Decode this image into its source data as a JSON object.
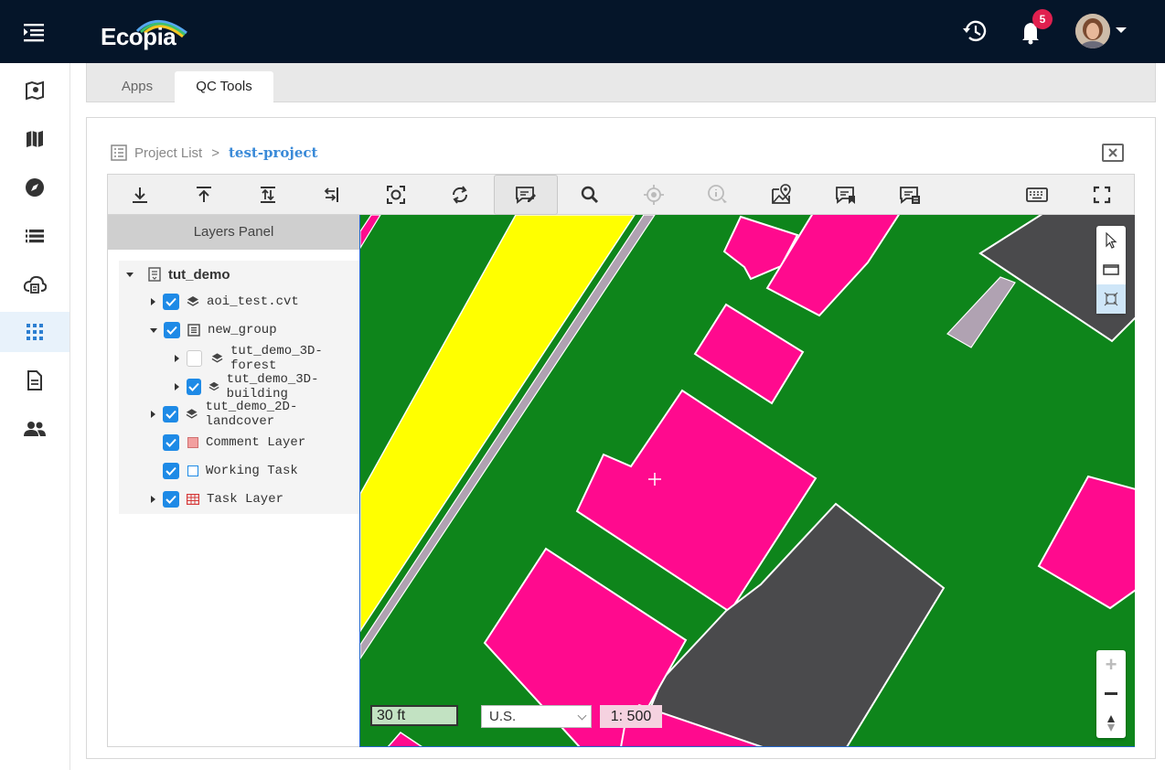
{
  "app": {
    "brand": "Ecopia",
    "notification_count": "5"
  },
  "icons": {
    "menu": "menu-expand-icon",
    "history": "history-icon",
    "notifications": "bell-icon",
    "profile": "avatar"
  },
  "sidebar": {
    "items": [
      {
        "name": "map-search",
        "icon": "map-marker-icon"
      },
      {
        "name": "map",
        "icon": "map-icon"
      },
      {
        "name": "explore",
        "icon": "compass-icon"
      },
      {
        "name": "list",
        "icon": "list-icon"
      },
      {
        "name": "cloud",
        "icon": "cloud-upload-icon"
      },
      {
        "name": "apps",
        "icon": "grid-icon",
        "active": true
      },
      {
        "name": "documents",
        "icon": "document-icon"
      },
      {
        "name": "users",
        "icon": "users-icon"
      }
    ]
  },
  "tabs": [
    {
      "label": "Apps",
      "active": false
    },
    {
      "label": "QC Tools",
      "active": true
    }
  ],
  "breadcrumb": {
    "parent": "Project List",
    "separator": ">",
    "current": "test-project"
  },
  "layers_panel": {
    "title": "Layers Panel",
    "tree": [
      {
        "label": "tut_demo",
        "type": "project",
        "expanded": true,
        "level": 0
      },
      {
        "label": "aoi_test.cvt",
        "type": "layer",
        "checked": true,
        "expanded": false,
        "level": 1
      },
      {
        "label": "new_group",
        "type": "group",
        "checked": true,
        "expanded": true,
        "level": 1
      },
      {
        "label": "tut_demo_3D-forest",
        "type": "layer",
        "checked": false,
        "expanded": false,
        "level": 2
      },
      {
        "label": "tut_demo_3D-building",
        "type": "layer",
        "checked": true,
        "expanded": false,
        "level": 2
      },
      {
        "label": "tut_demo_2D-landcover",
        "type": "layer",
        "checked": true,
        "expanded": false,
        "level": 1
      },
      {
        "label": "Comment Layer",
        "type": "comment",
        "checked": true,
        "level": 1
      },
      {
        "label": "Working Task",
        "type": "task",
        "checked": true,
        "level": 1
      },
      {
        "label": "Task Layer",
        "type": "grid",
        "checked": true,
        "expanded": false,
        "level": 1
      }
    ]
  },
  "map": {
    "scale_bar": "30 ft",
    "units": "U.S.",
    "scale_ratio": "1: 500",
    "colors": {
      "vegetation": "#0e851b",
      "building": "#ff0a8e",
      "road": "#ffff00",
      "paved": "#4a4a4c",
      "sidewalk": "#b0a2b2"
    }
  }
}
